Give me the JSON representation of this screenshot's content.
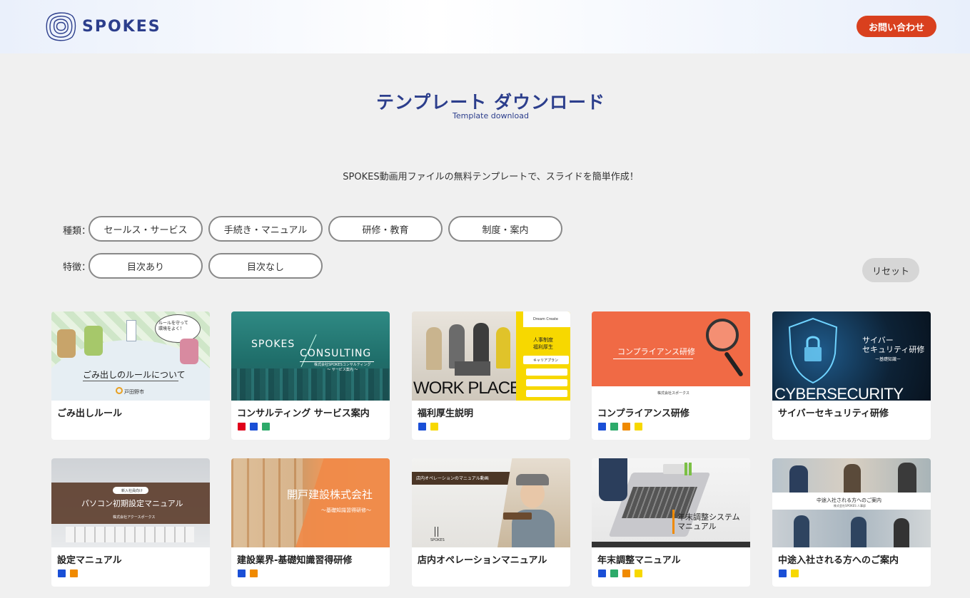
{
  "header": {
    "brand": "SPOKES",
    "contact_label": "お問い合わせ"
  },
  "page": {
    "title": "テンプレート ダウンロード",
    "subtitle": "Template download",
    "lead": "SPOKES動画用ファイルの無料テンプレートで、スライドを簡単作成！"
  },
  "filters": {
    "type_label": "種類：",
    "types": [
      "セールス・サービス",
      "手続き・マニュアル",
      "研修・教育",
      "制度・案内"
    ],
    "feature_label": "特徴：",
    "features": [
      "目次あり",
      "目次なし"
    ],
    "reset_label": "リセット"
  },
  "colors": {
    "accent": "#2c3e8c",
    "contact": "#d9401e",
    "red": "#e0001a",
    "blue": "#1a4fd6",
    "green": "#2daa6a",
    "orange": "#f08a00",
    "yellow": "#f7d800"
  },
  "cards": [
    {
      "title": "ごみ出しルール",
      "thumb_texts": [
        "ごみ出しのルールについて",
        "ルールを守って\n環境をよく！",
        "戸田野市"
      ],
      "color_tags": []
    },
    {
      "title": "コンサルティング サービス案内",
      "thumb_texts": [
        "SPOKES",
        "CONSULTING",
        "株式会社SPOKESコンサルティング\n〜 サービス案内 〜"
      ],
      "color_tags": [
        "red",
        "blue",
        "green"
      ]
    },
    {
      "title": "福利厚生説明",
      "thumb_texts": [
        "WORK PLACE",
        "人事制度\n福利厚生",
        "Dream Create",
        "キャリアプラン"
      ],
      "color_tags": [
        "blue",
        "yellow"
      ]
    },
    {
      "title": "コンプライアンス研修",
      "thumb_texts": [
        "コンプライアンス研修",
        "株式会社スポークス"
      ],
      "color_tags": [
        "blue",
        "green",
        "orange",
        "yellow"
      ]
    },
    {
      "title": "サイバーセキュリティ研修",
      "thumb_texts": [
        "サイバー\nセキュリティ研修",
        "ー基礎知識ー",
        "CYBERSECURITY"
      ],
      "color_tags": []
    },
    {
      "title": "設定マニュアル",
      "thumb_texts": [
        "新入社員向け",
        "パソコン初期設定マニュアル",
        "株式会社アクースポークス"
      ],
      "color_tags": [
        "blue",
        "orange"
      ]
    },
    {
      "title": "建設業界-基礎知識習得研修",
      "thumb_texts": [
        "開戸建設株式会社",
        "〜基礎知識習得研修〜"
      ],
      "color_tags": [
        "blue",
        "orange"
      ]
    },
    {
      "title": "店内オペレーションマニュアル",
      "thumb_texts": [
        "店内オペレーションのマニュアル動画",
        "SPOKES"
      ],
      "color_tags": []
    },
    {
      "title": "年末調整マニュアル",
      "thumb_texts": [
        "年末調整システム\nマニュアル"
      ],
      "color_tags": [
        "blue",
        "green",
        "orange",
        "yellow"
      ]
    },
    {
      "title": "中途入社される方へのご案内",
      "thumb_texts": [
        "中途入社される方へのご案内",
        "株式会社SPOKES 人事部"
      ],
      "color_tags": [
        "blue",
        "yellow"
      ]
    }
  ]
}
